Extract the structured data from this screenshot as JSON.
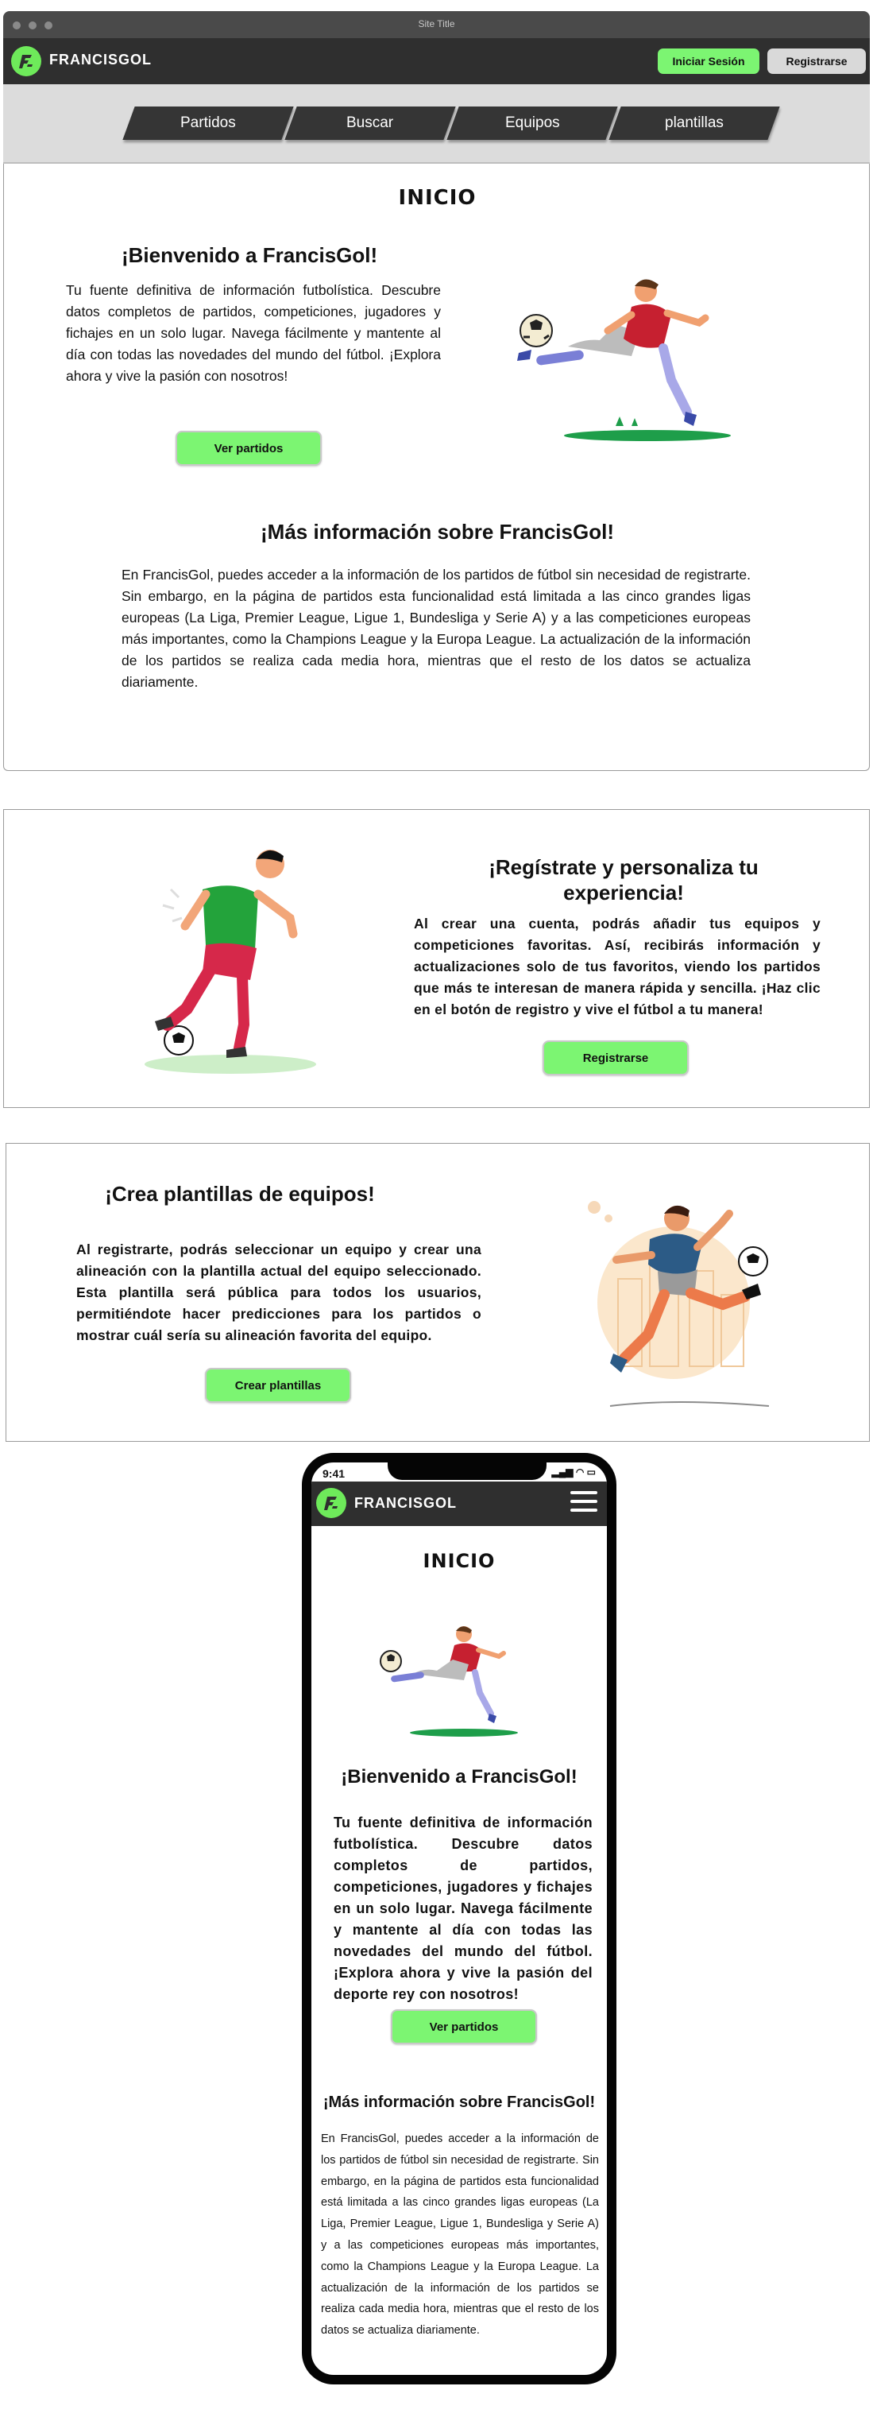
{
  "window": {
    "title": "Site Title"
  },
  "header": {
    "logo_text": "FRANCISGOL",
    "login_label": "Iniciar Sesión",
    "register_label": "Registrarse"
  },
  "nav": {
    "tabs": [
      {
        "label": "Partidos"
      },
      {
        "label": "Buscar"
      },
      {
        "label": "Equipos"
      },
      {
        "label": "plantillas"
      }
    ]
  },
  "home": {
    "page_title": "INICIO",
    "welcome_title": "¡Bienvenido a FrancisGol!",
    "welcome_text": "Tu fuente definitiva de información futbolística. Descubre datos completos de partidos, competiciones, jugadores y fichajes en un solo lugar. Navega fácilmente y mantente al día con todas las novedades del mundo del fútbol. ¡Explora ahora y vive la pasión con nosotros!",
    "matches_button": "Ver partidos",
    "more_title": "¡Más información sobre FrancisGol!",
    "more_text": "En FrancisGol, puedes acceder a la información de los partidos de fútbol sin necesidad de registrarte. Sin embargo, en la página de partidos esta funcionalidad está limitada a las cinco grandes ligas europeas (La Liga, Premier League, Ligue 1, Bundesliga y Serie A) y a las competiciones europeas más importantes, como la Champions League y la Europa League. La actualización de la información de los partidos se realiza cada media hora, mientras que el resto de los datos se actualiza diariamente."
  },
  "register_section": {
    "title": "¡Regístrate y personaliza tu experiencia!",
    "text": "Al crear una cuenta, podrás añadir tus equipos y competiciones favoritas. Así, recibirás información y actualizaciones solo de tus favoritos, viendo los partidos que más te interesan de manera rápida y sencilla. ¡Haz clic en el botón de registro y vive el fútbol a tu manera!",
    "button": "Registrarse"
  },
  "squads_section": {
    "title": "¡Crea plantillas de equipos!",
    "text": "Al registrarte, podrás seleccionar un equipo y crear una alineación con la plantilla actual del equipo seleccionado. Esta plantilla será pública para todos los usuarios, permitiéndote hacer predicciones para los partidos o mostrar cuál sería su alineación favorita del equipo.",
    "button": "Crear plantillas"
  },
  "mobile": {
    "status_time": "9:41",
    "logo_text": "FRANCISGOL",
    "page_title": "INICIO",
    "welcome_title": "¡Bienvenido a FrancisGol!",
    "welcome_text": "Tu fuente definitiva de información futbolística. Descubre datos completos de partidos, competiciones, jugadores y fichajes en un solo lugar. Navega fácilmente y mantente al día con todas las novedades del mundo del fútbol. ¡Explora ahora y vive la pasión del deporte rey con nosotros!",
    "matches_button": "Ver partidos",
    "more_title": "¡Más información sobre FrancisGol!",
    "more_text": "En FrancisGol, puedes acceder a la información de los partidos de fútbol sin necesidad de registrarte. Sin embargo, en la página de partidos esta funcionalidad está limitada a las cinco grandes ligas europeas (La Liga, Premier League, Ligue 1, Bundesliga y Serie A) y a las competiciones europeas más importantes, como la Champions League y la Europa League. La actualización de la información de los partidos se realiza cada media hora, mientras que el resto de los datos se actualiza diariamente."
  },
  "colors": {
    "accent": "#7cf572",
    "header_bg": "#2f2f2f",
    "nav_bg": "#dcdcdc",
    "tab_bg": "#353535"
  }
}
